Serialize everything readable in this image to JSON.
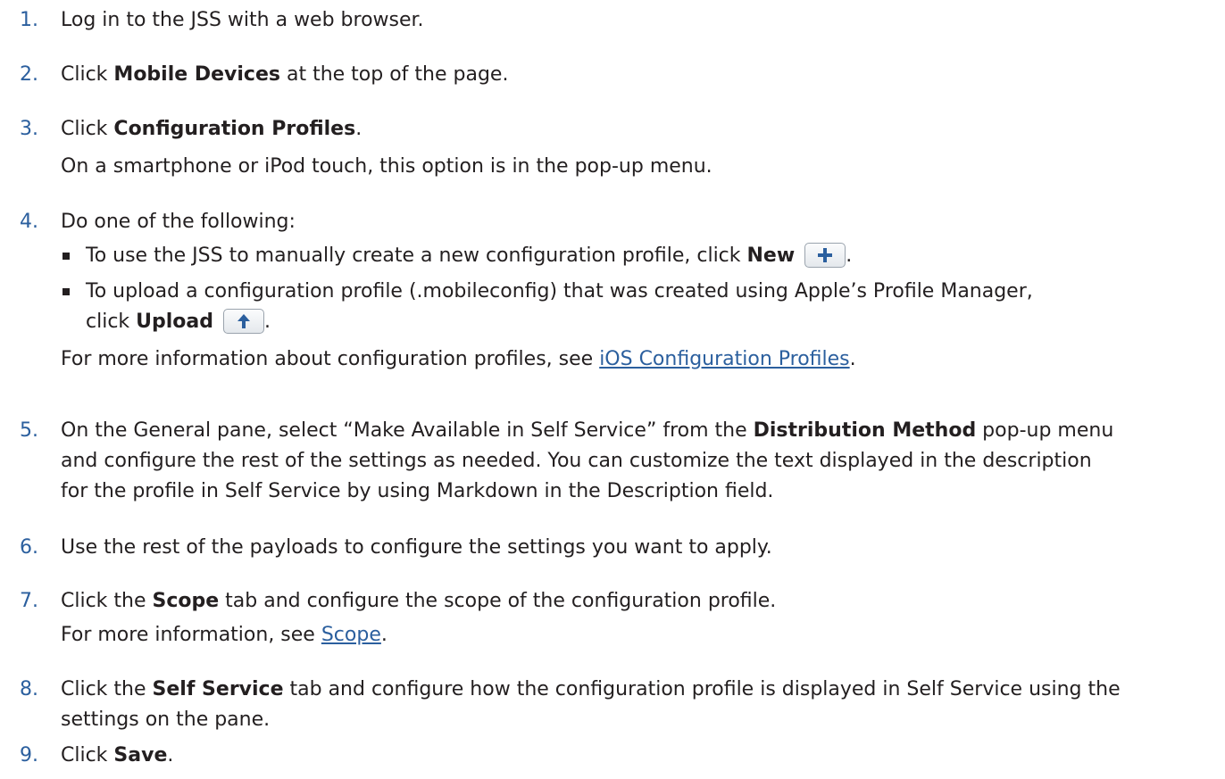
{
  "steps": [
    {
      "num": "1.",
      "text": "Log in to the JSS with a web browser."
    },
    {
      "num": "2.",
      "pre": "Click ",
      "bold": "Mobile Devices",
      "post": " at the top of the page."
    },
    {
      "num": "3.",
      "pre": "Click ",
      "bold": "Configuration Profiles",
      "post": ".",
      "note": "On a smartphone or iPod touch, this option is in the pop-up menu."
    },
    {
      "num": "4.",
      "text": "Do one of the following:",
      "bullets": [
        {
          "pre": "To use the JSS to manually create a new configuration profile, click ",
          "bold": "New",
          "icon": "plus-icon",
          "post": "."
        },
        {
          "pre": "To upload a configuration profile (.mobileconfig) that was created using Apple’s Profile Manager,",
          "pre2": "click ",
          "bold": "Upload",
          "icon": "up-arrow-icon",
          "post": "."
        }
      ],
      "note_pre": "For more information about configuration profiles, see ",
      "note_link": "iOS Configuration Profiles",
      "note_post": "."
    },
    {
      "num": "5.",
      "lines": [
        "On the General pane, select “Make Available in Self Service” from the ",
        "Distribution Method",
        " pop-up menu",
        "and configure the rest of the settings as needed. You can customize the text displayed in the description",
        "for the profile in Self Service by using Markdown in the Description field."
      ]
    },
    {
      "num": "6.",
      "text": "Use the rest of the payloads to configure the settings you want to apply."
    },
    {
      "num": "7.",
      "pre": "Click the ",
      "bold": "Scope",
      "post": " tab and configure the scope of the configuration profile.",
      "note_pre": "For more information, see ",
      "note_link": "Scope",
      "note_post": "."
    },
    {
      "num": "8.",
      "pre": "Click the ",
      "bold": "Self Service",
      "post": " tab and configure how the configuration profile is displayed in Self Service using the",
      "line2": "settings on the pane."
    },
    {
      "num": "9.",
      "pre": "Click ",
      "bold": "Save",
      "post": "."
    }
  ],
  "colors": {
    "step_number": "#2b5f9e",
    "link": "#2b5f9e",
    "text": "#231f20"
  }
}
